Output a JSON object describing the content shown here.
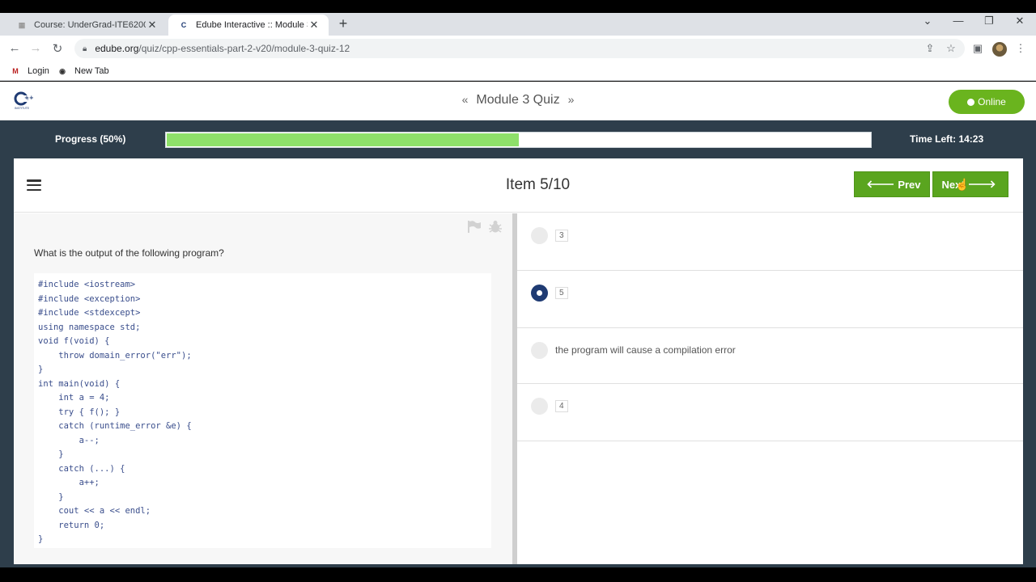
{
  "browser": {
    "tabs": [
      {
        "title": "Course: UnderGrad-ITE6200A-22",
        "active": false
      },
      {
        "title": "Edube Interactive :: Module 3 Qu",
        "active": true
      }
    ],
    "url_host": "edube.org",
    "url_path": "/quiz/cpp-essentials-part-2-v20/module-3-quiz-12",
    "bookmarks": [
      {
        "label": "Login"
      },
      {
        "label": "New Tab"
      }
    ]
  },
  "header": {
    "title": "Module 3 Quiz",
    "online_label": "Online"
  },
  "progress": {
    "label": "Progress (50%)",
    "fraction": 0.5,
    "time_left": "Time Left: 14:23"
  },
  "item": {
    "title": "Item 5/10",
    "prev_label": "Prev",
    "next_label": "Next"
  },
  "question": {
    "text": "What is the output of the following program?",
    "code": "#include <iostream>\n#include <exception>\n#include <stdexcept>\nusing namespace std;\nvoid f(void) {\n    throw domain_error(\"err\");\n}\nint main(void) {\n    int a = 4;\n    try { f(); }\n    catch (runtime_error &e) {\n        a--;\n    }\n    catch (...) {\n        a++;\n    }\n    cout << a << endl;\n    return 0;\n}"
  },
  "options": [
    {
      "text": "3",
      "selected": false
    },
    {
      "text": "5",
      "selected": true
    },
    {
      "text": "the program will cause a compilation error",
      "selected": false
    },
    {
      "text": "4",
      "selected": false
    }
  ],
  "colors": {
    "accent_green": "#5aa51f",
    "progress_green": "#8ee06a",
    "dark_bg": "#2e3e4b",
    "radio_selected": "#1f3b73"
  }
}
